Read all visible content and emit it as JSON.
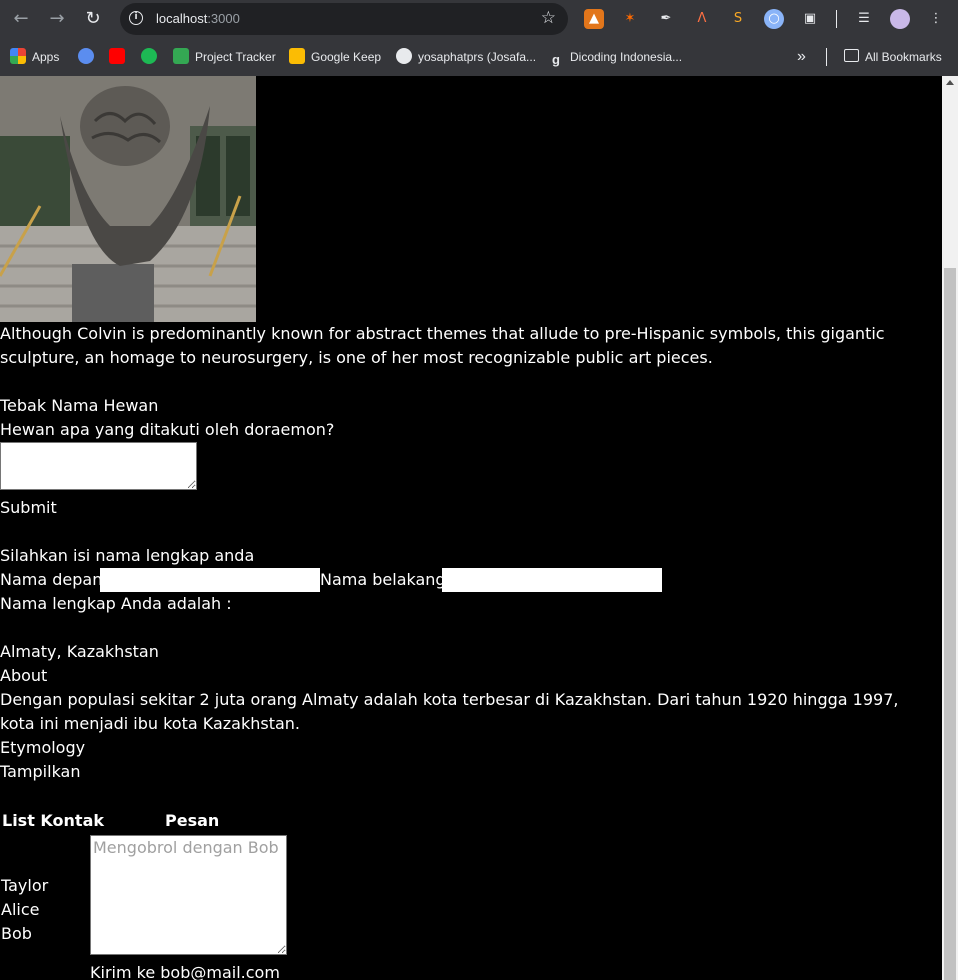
{
  "browser": {
    "url_host": "localhost",
    "url_port": ":3000",
    "bookmarks": [
      {
        "label": "Apps",
        "icon": "apps-grid-icon"
      },
      {
        "label": "",
        "icon": "google-photos-icon"
      },
      {
        "label": "",
        "icon": "youtube-icon"
      },
      {
        "label": "",
        "icon": "spotify-icon"
      },
      {
        "label": "Project Tracker",
        "icon": "project-tracker-icon"
      },
      {
        "label": "Google Keep",
        "icon": "google-keep-icon"
      },
      {
        "label": "yosaphatprs (Josafa...",
        "icon": "github-icon"
      },
      {
        "label": "Dicoding Indonesia...",
        "icon": "dicoding-icon"
      }
    ],
    "overflow_label": "»",
    "all_bookmarks_label": "All Bookmarks",
    "colors": {
      "chrome": "#35363a",
      "omnibox": "#202124",
      "text": "#e8eaed"
    }
  },
  "page": {
    "caption": "Although Colvin is predominantly known for abstract themes that allude to pre-Hispanic symbols, this gigantic sculpture, an homage to neurosurgery, is one of her most recognizable public art pieces.",
    "quiz": {
      "title": "Tebak Nama Hewan",
      "question": "Hewan apa yang ditakuti oleh doraemon?",
      "answer_value": "",
      "submit_label": "Submit"
    },
    "name_form": {
      "prompt": "Silahkan isi nama lengkap anda",
      "first_label": "Nama depan:",
      "first_value": "",
      "last_label": "Nama belakang:",
      "last_value": "",
      "result_label": "Nama lengkap Anda adalah :"
    },
    "city": {
      "name": "Almaty, Kazakhstan",
      "about_label": "About",
      "about_text": "Dengan populasi sekitar 2 juta orang Almaty adalah kota terbesar di Kazakhstan. Dari tahun 1920 hingga 1997, kota ini menjadi ibu kota Kazakhstan.",
      "etymology_label": "Etymology",
      "show_label": "Tampilkan"
    },
    "chat": {
      "contacts_header": "List Kontak",
      "message_header": "Pesan",
      "contacts": [
        "Taylor",
        "Alice",
        "Bob"
      ],
      "message_placeholder": "Mengobrol dengan Bob",
      "send_label": "Kirim ke bob@mail.com"
    }
  }
}
